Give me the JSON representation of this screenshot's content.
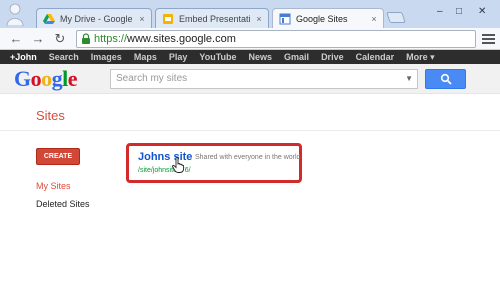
{
  "browser": {
    "tabs": [
      {
        "label": "My Drive - Google Drive",
        "icon": "google-drive-icon",
        "close": "×"
      },
      {
        "label": "Embed Presentation - Goo",
        "icon": "slides-icon",
        "close": "×"
      },
      {
        "label": "Google Sites",
        "icon": "google-sites-icon",
        "close": "×",
        "active": true
      }
    ],
    "window_controls": {
      "minimize": "–",
      "maximize": "□",
      "close": "✕"
    },
    "nav": {
      "back": "←",
      "forward": "→",
      "reload": "↻"
    },
    "url_scheme": "https://",
    "url_host": "www.sites.google.com"
  },
  "gbar": {
    "items": [
      "+John",
      "Search",
      "Images",
      "Maps",
      "Play",
      "YouTube",
      "News",
      "Gmail",
      "Drive",
      "Calendar",
      "More ▾"
    ]
  },
  "header": {
    "logo_letters": [
      {
        "ch": "G",
        "color": "#3369e8"
      },
      {
        "ch": "o",
        "color": "#d50f25"
      },
      {
        "ch": "o",
        "color": "#eeb211"
      },
      {
        "ch": "g",
        "color": "#3369e8"
      },
      {
        "ch": "l",
        "color": "#009925"
      },
      {
        "ch": "e",
        "color": "#d50f25"
      }
    ],
    "search_placeholder": "Search my sites",
    "search_caret": "▼"
  },
  "page": {
    "title": "Sites",
    "create_label": "CREATE",
    "leftnav": [
      {
        "label": "My Sites",
        "active": true
      },
      {
        "label": "Deleted Sites",
        "active": false
      }
    ],
    "site": {
      "name": "Johns site",
      "sharing": "Shared with everyone in the world",
      "url": "/site/johnsite776/"
    }
  },
  "colors": {
    "accent_red": "#dd4b39",
    "highlight_box": "#d12b2b",
    "link_blue": "#1155cc",
    "url_green": "#009933"
  }
}
